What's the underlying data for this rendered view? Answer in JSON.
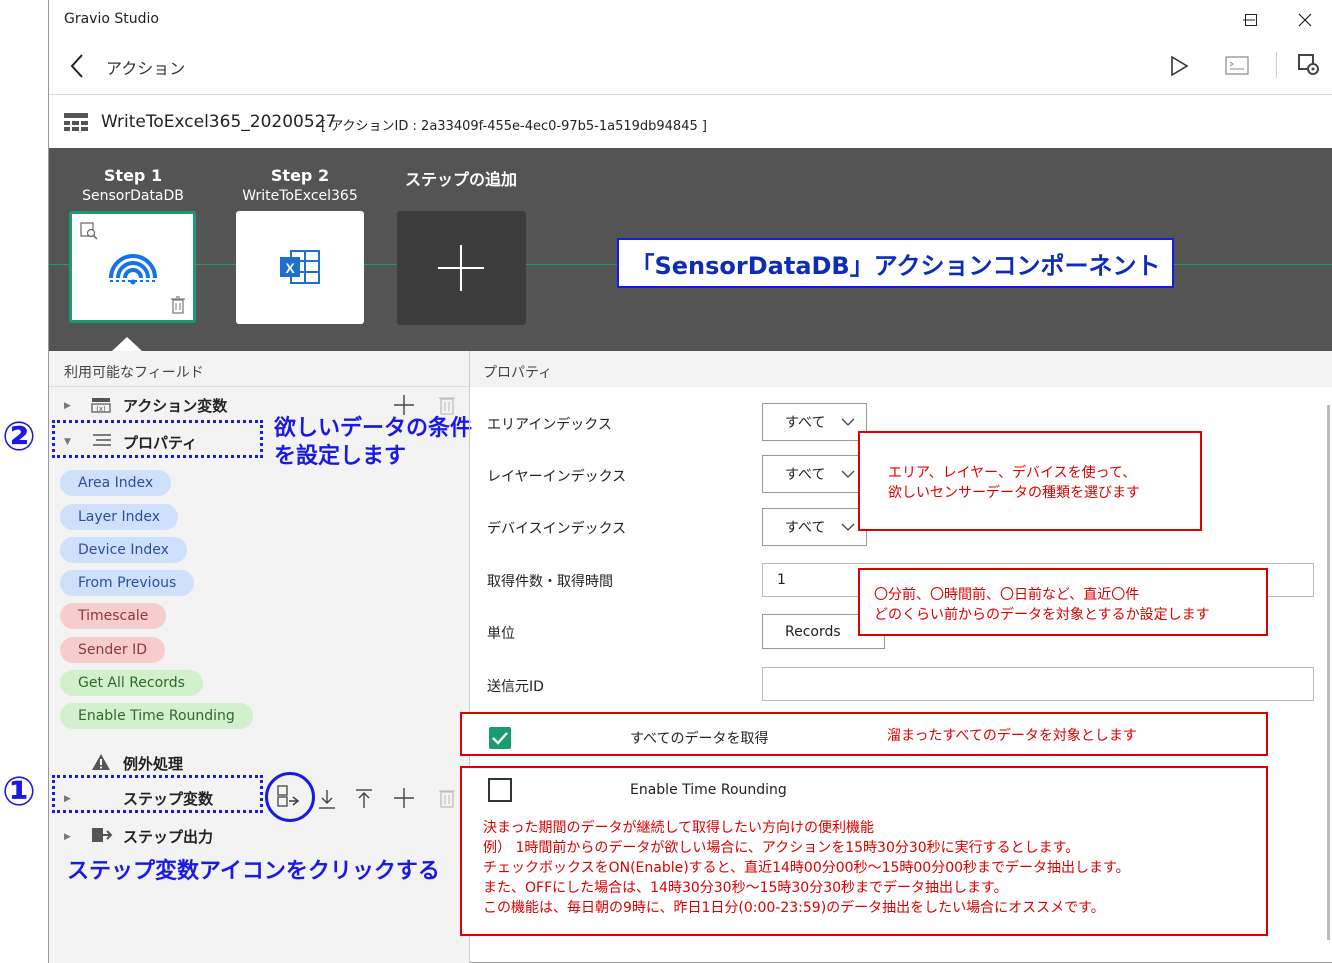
{
  "window": {
    "title": "Gravio Studio"
  },
  "nav": {
    "title": "アクション"
  },
  "action": {
    "name": "WriteToExcel365_20200527",
    "id_text": "[ アクションID : 2a33409f-455e-4ec0-97b5-1a519db94845 ]"
  },
  "steps": [
    {
      "label": "Step 1",
      "sub": "SensorDataDB"
    },
    {
      "label": "Step 2",
      "sub": "WriteToExcel365"
    },
    {
      "label": "ステップの追加",
      "sub": ""
    }
  ],
  "callouts": {
    "component": "「SensorDataDB」アクションコンポーネント",
    "fields_line1": "エリア、レイヤー、デバイスを使って、",
    "fields_line2": "欲しいセンサーデータの種類を選びます",
    "count_line1": "〇分前、〇時間前、〇日前など、直近〇件",
    "count_line2": "どのくらい前からのデータを対象とするか設定します",
    "all_records": "溜まったすべてのデータを対象とします",
    "rounding_lines": [
      "決まった期間のデータが継続して取得したい方向けの便利機能",
      "例）  1時間前からのデータが欲しい場合に、アクションを15時30分30秒に実行するとします。",
      "チェックボックスをON(Enable)すると、直近14時00分00秒～15時00分00秒までデータ抽出します。",
      "また、OFFにした場合は、14時30分30秒～15時30分30秒までデータ抽出します。",
      "この機能は、毎日朝の9時に、昨日1日分(0:00-23:59)のデータ抽出をしたい場合にオススメです。"
    ]
  },
  "left_panel": {
    "header": "利用可能なフィールド",
    "action_vars": "アクション変数",
    "properties": "プロパティ",
    "chips": [
      {
        "label": "Area Index",
        "color": "blue"
      },
      {
        "label": "Layer Index",
        "color": "blue"
      },
      {
        "label": "Device Index",
        "color": "blue"
      },
      {
        "label": "From Previous",
        "color": "blue"
      },
      {
        "label": "Timescale",
        "color": "red"
      },
      {
        "label": "Sender ID",
        "color": "red"
      },
      {
        "label": "Get All Records",
        "color": "green"
      },
      {
        "label": "Enable Time Rounding",
        "color": "green"
      }
    ],
    "exception": "例外処理",
    "step_vars": "ステップ変数",
    "step_output": "ステップ出力"
  },
  "annotations": {
    "num1": "①",
    "num2": "②",
    "note2_line1": "欲しいデータの条件",
    "note2_line2": "を設定します",
    "note1": "ステップ変数アイコンをクリックする"
  },
  "properties_panel": {
    "header": "プロパティ",
    "area_label": "エリアインデックス",
    "area_value": "すべて",
    "layer_label": "レイヤーインデックス",
    "layer_value": "すべて",
    "device_label": "デバイスインデックス",
    "device_value": "すべて",
    "count_label": "取得件数・取得時間",
    "count_value": "1",
    "unit_label": "単位",
    "unit_value": "Records",
    "sender_label": "送信元ID",
    "sender_value": "",
    "all_records_label": "すべてのデータを取得",
    "all_records_checked": true,
    "rounding_label": "Enable Time Rounding",
    "rounding_checked": false
  },
  "colors": {
    "accent_green": "#1a9c6e",
    "annotation_blue": "#1a1ae6",
    "annotation_red": "#e00000",
    "step_bar": "#545454"
  }
}
